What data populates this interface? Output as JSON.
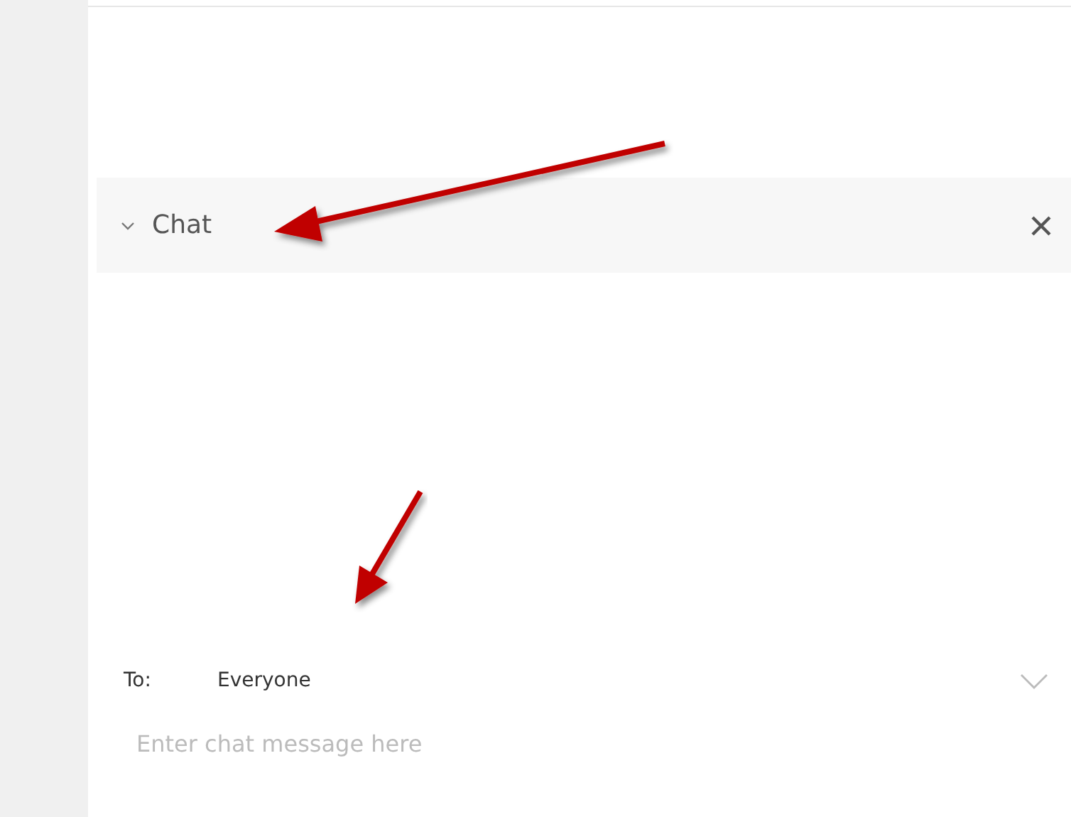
{
  "chat": {
    "title": "Chat",
    "expanded": true
  },
  "recipient": {
    "label": "To:",
    "value": "Everyone"
  },
  "message": {
    "placeholder": "Enter chat message here"
  }
}
